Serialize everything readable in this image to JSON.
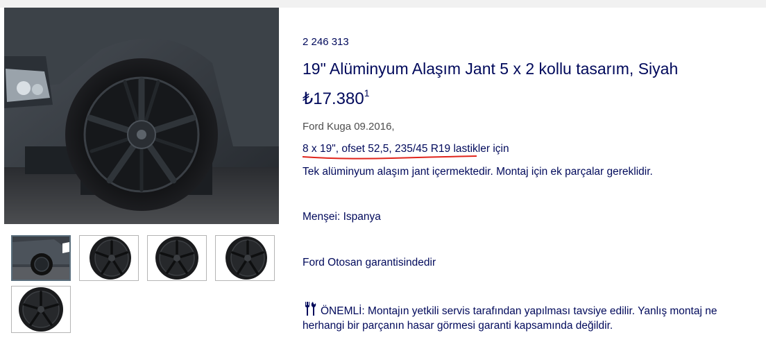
{
  "product": {
    "sku": "2 246 313",
    "title": "19\" Alüminyum Alaşım Jant 5 x 2 kollu tasarım, Siyah",
    "price": "₺17.380",
    "price_footnote": "1",
    "model": "Ford Kuga 09.2016,",
    "spec_text": "8 x 19\", ofset 52,5, 235/45 R19 lastikler için",
    "description": "Tek alüminyum alaşım jant içermektedir. Montaj için ek parçalar gereklidir.",
    "origin": "Menşei: Ispanya",
    "warranty": "Ford Otosan garantisindedir",
    "important_text": "ÖNEMLİ: Montajın yetkili servis tarafından yapılması tavsiye edilir. Yanlış montaj ne",
    "important_text_2": "herhangi bir parçanın hasar görmesi garanti kapsamında değildir."
  },
  "gallery": {
    "thumbnails": [
      "car-side-photo",
      "wheel-angle-photo",
      "wheel-front-photo",
      "wheel-angle-photo",
      "wheel-front-photo"
    ]
  },
  "icons": {
    "important": "tools-icon"
  },
  "colors": {
    "text_primary": "#00095b",
    "text_muted": "#4d4d4d",
    "underline_annotation": "#e0241b",
    "thumb_border": "#b4b4b4"
  }
}
